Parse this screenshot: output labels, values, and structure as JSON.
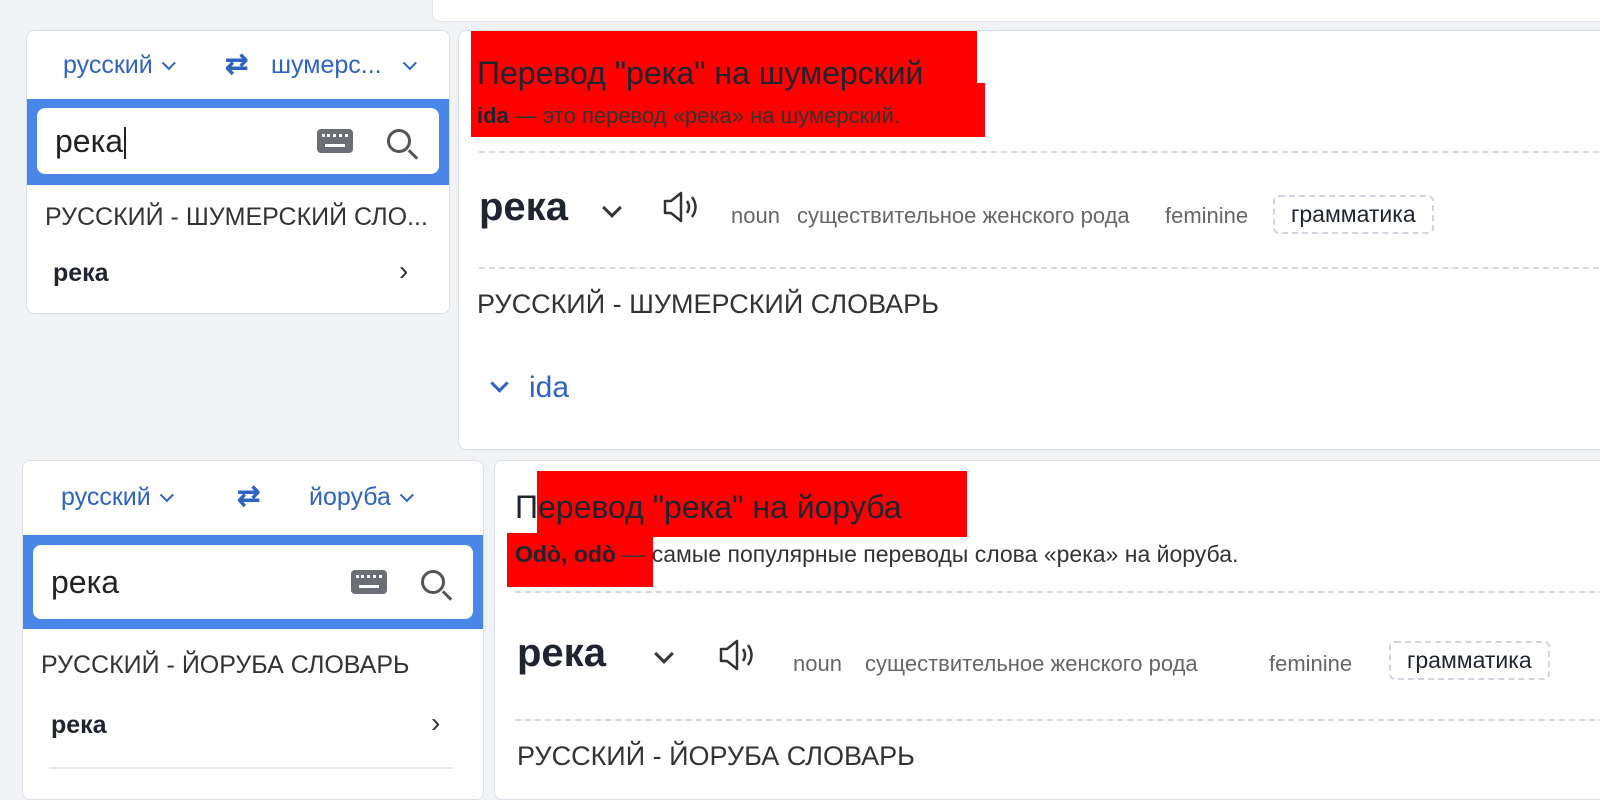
{
  "panel1": {
    "source_lang": "русский",
    "target_lang": "шумерс...",
    "query": "река",
    "dict_label": "РУССКИЙ - ШУМЕРСКИЙ СЛО...",
    "entry": "река",
    "title": "Перевод \"река\" на шумерский",
    "subtitle_bold": "ida",
    "subtitle_rest": " — это перевод «река» на шумерский.",
    "word": "река",
    "pos": "noun",
    "gender_desc": "существительное женского рода",
    "gender": "feminine",
    "grammar_button": "грамматика",
    "dict_heading": "РУССКИЙ - ШУМЕРСКИЙ СЛОВАРЬ",
    "translation": "ida"
  },
  "panel2": {
    "source_lang": "русский",
    "target_lang": "йоруба",
    "query": "река",
    "dict_label": "РУССКИЙ - ЙОРУБА СЛОВАРЬ",
    "entry": "река",
    "title": "Перевод \"река\" на йоруба",
    "subtitle_bold": "Odò, odò",
    "subtitle_dash": " — ",
    "subtitle_rest": "самые популярные переводы слова «река» на йоруба.",
    "word": "река",
    "pos": "noun",
    "gender_desc": "существительное женского рода",
    "gender": "feminine",
    "grammar_button": "грамматика",
    "dict_heading": "РУССКИЙ - ЙОРУБА СЛОВАРЬ"
  },
  "colors": {
    "accent": "#2f63c3",
    "search_border": "#4a86e8",
    "highlight": "#ff0000"
  },
  "icons": [
    "chevron-down-icon",
    "swap-icon",
    "keyboard-icon",
    "search-icon",
    "chevron-right-icon",
    "speaker-icon"
  ]
}
